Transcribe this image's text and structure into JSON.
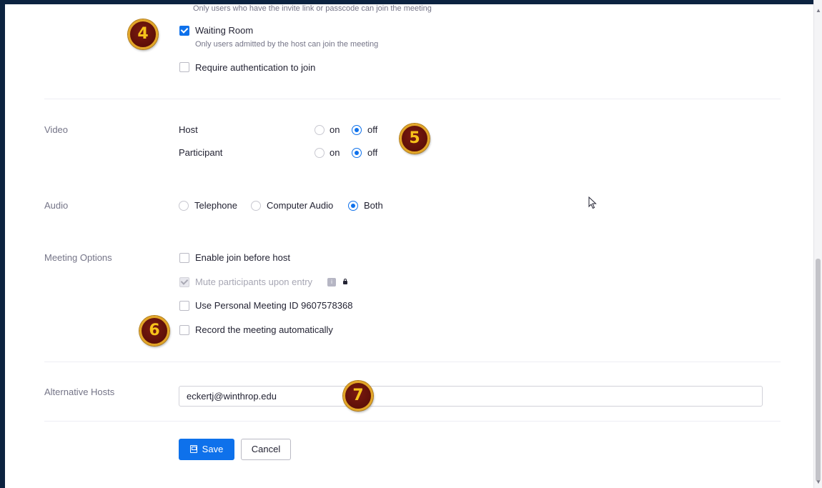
{
  "security": {
    "passcode_hint": "Only users who have the invite link or passcode can join the meeting",
    "waiting_room_label": "Waiting Room",
    "waiting_room_checked": true,
    "waiting_room_hint": "Only users admitted by the host can join the meeting",
    "require_auth_label": "Require authentication to join",
    "require_auth_checked": false
  },
  "video": {
    "label": "Video",
    "host_label": "Host",
    "participant_label": "Participant",
    "on_label": "on",
    "off_label": "off",
    "host_value": "off",
    "participant_value": "off"
  },
  "audio": {
    "label": "Audio",
    "options": [
      "Telephone",
      "Computer Audio",
      "Both"
    ],
    "selected": "Both"
  },
  "meeting_options": {
    "label": "Meeting Options",
    "items": [
      {
        "label": "Enable join before host",
        "checked": false,
        "disabled": false
      },
      {
        "label": "Mute participants upon entry",
        "checked": true,
        "disabled": true
      },
      {
        "label": "Use Personal Meeting ID 9607578368",
        "checked": false,
        "disabled": false
      },
      {
        "label": "Record the meeting automatically",
        "checked": false,
        "disabled": false
      }
    ]
  },
  "alternative_hosts": {
    "label": "Alternative Hosts",
    "value": "eckertj@winthrop.edu"
  },
  "actions": {
    "save_label": "Save",
    "cancel_label": "Cancel"
  },
  "callouts": [
    "4",
    "5",
    "6",
    "7"
  ],
  "colors": {
    "accent": "#0e71eb",
    "frame": "#0c2340",
    "badge_fill": "#6b140c",
    "badge_ring": "#e2a526",
    "badge_text": "#f7c31a"
  },
  "icons": [
    "check-icon",
    "info-icon",
    "lock-icon",
    "save-icon",
    "mouse-cursor-icon"
  ]
}
